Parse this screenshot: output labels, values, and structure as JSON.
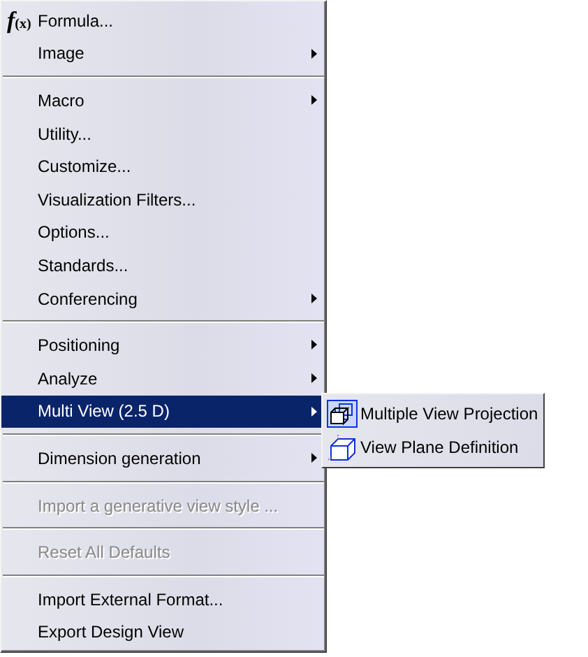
{
  "menu": {
    "groups": [
      [
        {
          "label": "Formula...",
          "kind": "formula",
          "icon_text": [
            "f",
            "(x)"
          ],
          "has_submenu": false,
          "selected": false,
          "disabled": false
        },
        {
          "label": "Image",
          "kind": "plain",
          "has_submenu": true,
          "selected": false,
          "disabled": false
        }
      ],
      [
        {
          "label": "Macro",
          "kind": "plain",
          "has_submenu": true,
          "selected": false,
          "disabled": false
        },
        {
          "label": "Utility...",
          "kind": "plain",
          "has_submenu": false,
          "selected": false,
          "disabled": false
        },
        {
          "label": "Customize...",
          "kind": "plain",
          "has_submenu": false,
          "selected": false,
          "disabled": false
        },
        {
          "label": "Visualization Filters...",
          "kind": "plain",
          "has_submenu": false,
          "selected": false,
          "disabled": false
        },
        {
          "label": "Options...",
          "kind": "plain",
          "has_submenu": false,
          "selected": false,
          "disabled": false
        },
        {
          "label": "Standards...",
          "kind": "plain",
          "has_submenu": false,
          "selected": false,
          "disabled": false
        },
        {
          "label": "Conferencing",
          "kind": "plain",
          "has_submenu": true,
          "selected": false,
          "disabled": false
        }
      ],
      [
        {
          "label": "Positioning",
          "kind": "plain",
          "has_submenu": true,
          "selected": false,
          "disabled": false
        },
        {
          "label": "Analyze",
          "kind": "plain",
          "has_submenu": true,
          "selected": false,
          "disabled": false
        },
        {
          "label": "Multi View (2.5 D)",
          "kind": "plain",
          "has_submenu": true,
          "selected": true,
          "disabled": false
        }
      ],
      [
        {
          "label": "Dimension generation",
          "kind": "plain",
          "has_submenu": true,
          "selected": false,
          "disabled": false
        }
      ],
      [
        {
          "label": "Import a generative view style ...",
          "kind": "plain",
          "has_submenu": false,
          "selected": false,
          "disabled": true
        }
      ],
      [
        {
          "label": "Reset All Defaults",
          "kind": "plain",
          "has_submenu": false,
          "selected": false,
          "disabled": true
        }
      ],
      [
        {
          "label": "Import External Format...",
          "kind": "plain",
          "has_submenu": false,
          "selected": false,
          "disabled": false
        },
        {
          "label": "Export Design View",
          "kind": "plain",
          "has_submenu": false,
          "selected": false,
          "disabled": false
        }
      ]
    ]
  },
  "submenu": {
    "items": [
      {
        "label": "Multiple View Projection",
        "kind": "projection",
        "selected": false
      },
      {
        "label": "View Plane Definition",
        "kind": "plane",
        "selected": false
      }
    ]
  }
}
